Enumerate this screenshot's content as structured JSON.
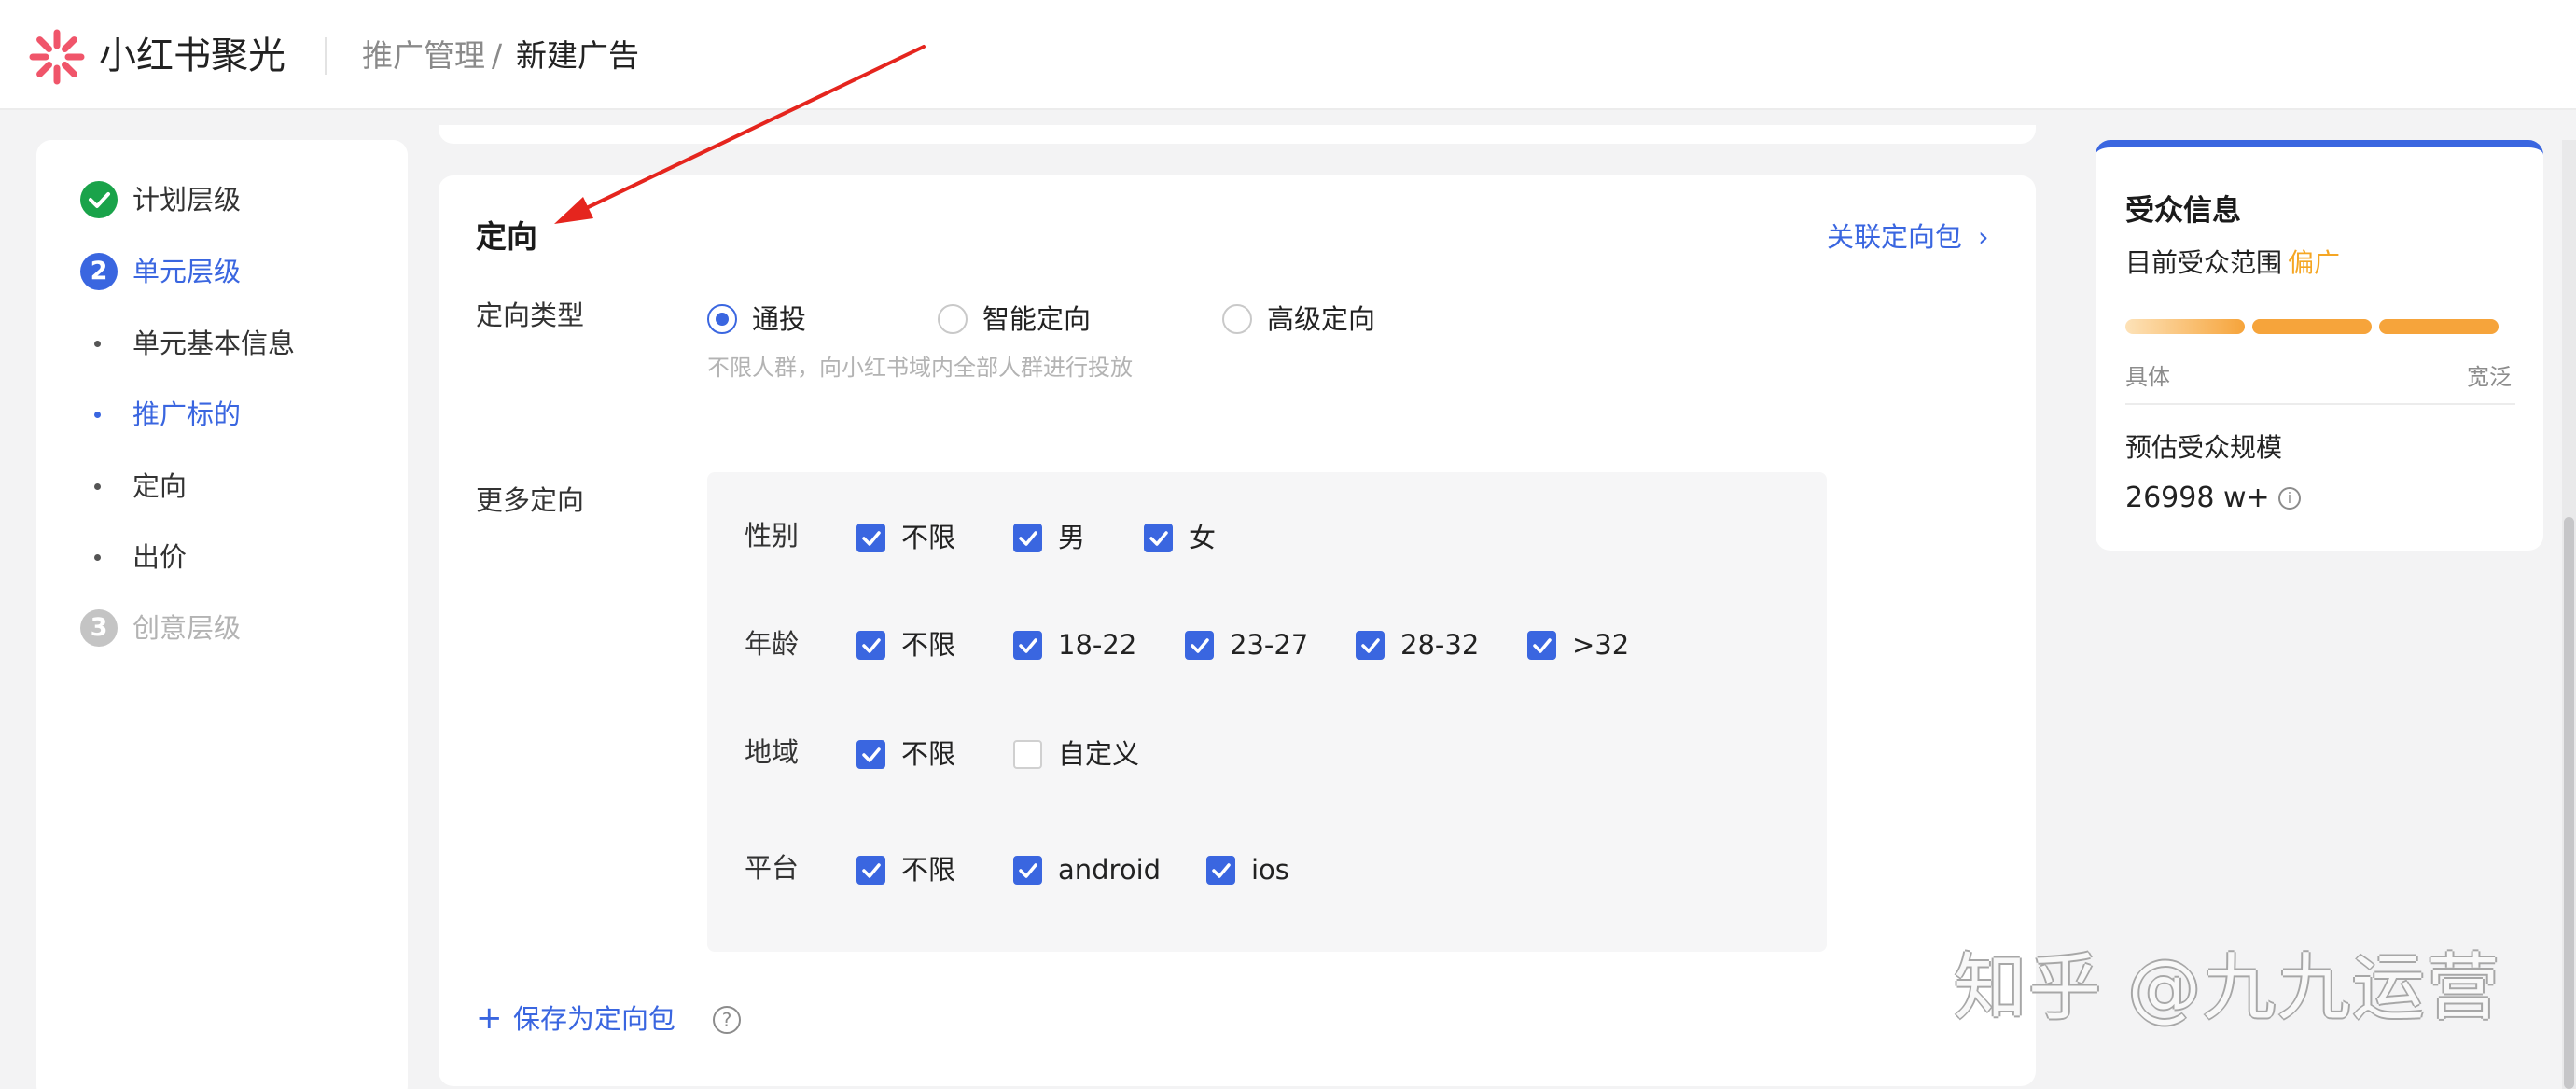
{
  "header": {
    "logo_text": "小红书聚光",
    "breadcrumb": {
      "parent": "推广管理",
      "separator": "/",
      "current": "新建广告"
    }
  },
  "steps": [
    {
      "label": "计划层级",
      "badge": "✓",
      "state": "done"
    },
    {
      "label": "单元层级",
      "badge": "2",
      "state": "active"
    },
    {
      "label": "单元基本信息",
      "state": "sub"
    },
    {
      "label": "推广标的",
      "state": "sub-active"
    },
    {
      "label": "定向",
      "state": "sub"
    },
    {
      "label": "出价",
      "state": "sub"
    },
    {
      "label": "创意层级",
      "badge": "3",
      "state": "pending"
    }
  ],
  "targeting": {
    "title": "定向",
    "link_pack": "关联定向包",
    "link_chevron": "›",
    "type_label": "定向类型",
    "type_options": [
      {
        "label": "通投",
        "selected": true
      },
      {
        "label": "智能定向",
        "selected": false
      },
      {
        "label": "高级定向",
        "selected": false
      }
    ],
    "type_hint": "不限人群，向小红书域内全部人群进行投放",
    "more_label": "更多定向",
    "groups": [
      {
        "label": "性别",
        "options": [
          {
            "label": "不限",
            "checked": true
          },
          {
            "label": "男",
            "checked": true
          },
          {
            "label": "女",
            "checked": true
          }
        ]
      },
      {
        "label": "年龄",
        "options": [
          {
            "label": "不限",
            "checked": true
          },
          {
            "label": "18-22",
            "checked": true
          },
          {
            "label": "23-27",
            "checked": true
          },
          {
            "label": "28-32",
            "checked": true
          },
          {
            "label": ">32",
            "checked": true
          }
        ]
      },
      {
        "label": "地域",
        "options": [
          {
            "label": "不限",
            "checked": true
          },
          {
            "label": "自定义",
            "checked": false
          }
        ]
      },
      {
        "label": "平台",
        "options": [
          {
            "label": "不限",
            "checked": true
          },
          {
            "label": "android",
            "checked": true
          },
          {
            "label": "ios",
            "checked": true
          }
        ]
      }
    ],
    "save_plus": "+",
    "save_label": "保存为定向包",
    "save_help": "?"
  },
  "audience": {
    "title": "受众信息",
    "range_label": "目前受众范围",
    "range_value": "偏广",
    "scale_min": "具体",
    "scale_max": "宽泛",
    "estimate_label": "预估受众规模",
    "estimate_value": "26998 w+",
    "info_glyph": "i"
  },
  "watermark": "知乎 @九九运营",
  "colors": {
    "accent": "#3a66e0",
    "success": "#1aa34a",
    "warning": "#f5a623",
    "annotation_arrow": "#e5251e"
  }
}
